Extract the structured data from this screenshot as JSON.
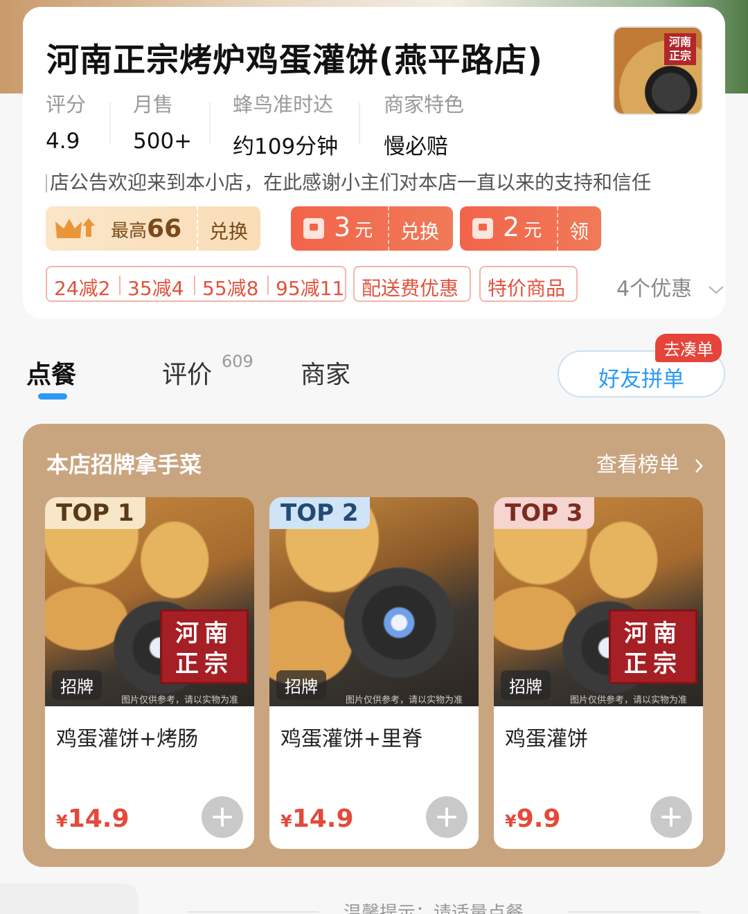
{
  "shop": {
    "name": "河南正宗烤炉鸡蛋灌饼(燕平路店)",
    "logo_stamp": "河正南宗",
    "stats": [
      {
        "label": "评分",
        "value": "4.9"
      },
      {
        "label": "月售",
        "value": "500+"
      },
      {
        "label": "蜂鸟准时达",
        "value": "约109分钟"
      },
      {
        "label": "商家特色",
        "value": "慢必赔"
      }
    ],
    "notice": "店公告欢迎来到本小店，在此感谢小主们对本店一直以来的支持和信任"
  },
  "coupons": {
    "vip": {
      "prefix": "最高",
      "amount": "66",
      "action": "兑换"
    },
    "red1": {
      "amount": "3",
      "unit": "元",
      "action": "兑换"
    },
    "red2": {
      "amount": "2",
      "unit": "元",
      "action": "领"
    }
  },
  "discounts": {
    "tiers": [
      "24减2",
      "35减4",
      "55减8",
      "95减11"
    ],
    "delivery": "配送费优惠",
    "special": "特价商品",
    "more": "4个优惠"
  },
  "tabs": {
    "order": "点餐",
    "reviews": "评价",
    "reviews_count": "609",
    "merchant": "商家",
    "group_button": "好友拼单",
    "group_badge": "去凑单"
  },
  "signature": {
    "title": "本店招牌拿手菜",
    "more": "查看榜单",
    "dishes": [
      {
        "rank": "TOP 1",
        "tag": "招牌",
        "name": "鸡蛋灌饼+烤肠",
        "currency": "¥",
        "price": "14.9",
        "stamp": "河正南宗",
        "disclaimer": "图片仅供参考，请以实物为准"
      },
      {
        "rank": "TOP 2",
        "tag": "招牌",
        "name": "鸡蛋灌饼+里脊",
        "currency": "¥",
        "price": "14.9",
        "stamp": "",
        "disclaimer": "图片仅供参考，请以实物为准"
      },
      {
        "rank": "TOP 3",
        "tag": "招牌",
        "name": "鸡蛋灌饼",
        "currency": "¥",
        "price": "9.9",
        "stamp": "河正南宗",
        "disclaimer": "图片仅供参考，请以实物为准"
      }
    ]
  },
  "footer": {
    "hint": "温馨提示：请适量点餐"
  },
  "colors": {
    "accent_blue": "#2b9af3",
    "coupon_red": "#f2644a",
    "price_red": "#e4493a",
    "signature_bg": "#c9a57f"
  },
  "icons": [
    "crown-icon",
    "red-packet-icon",
    "chevron-down-icon",
    "chevron-right-icon",
    "add-icon"
  ]
}
